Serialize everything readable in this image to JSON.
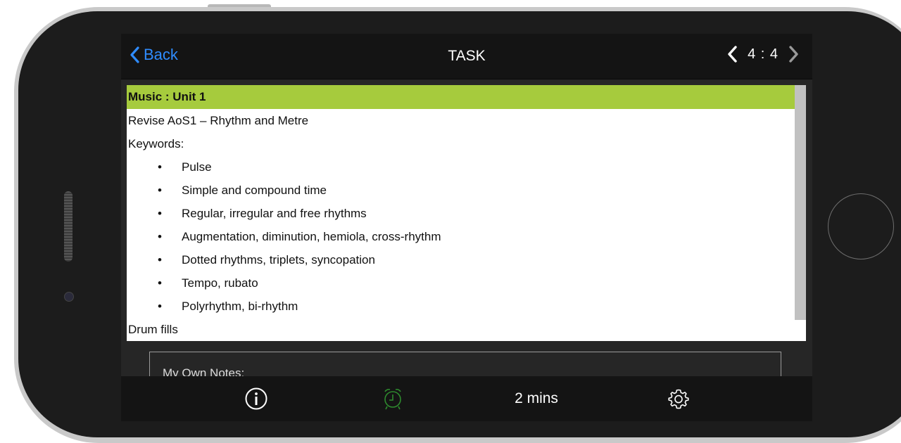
{
  "navbar": {
    "back_label": "Back",
    "title": "TASK",
    "pager_text": "4 : 4"
  },
  "task": {
    "subject": "Music : Unit 1",
    "lines": [
      "Revise AoS1 – Rhythm and Metre",
      "Keywords:"
    ],
    "bullet_char": "•",
    "bullets": [
      "Pulse",
      "Simple and compound time",
      "Regular, irregular and free rhythms",
      "Augmentation, diminution, hemiola, cross-rhythm",
      "Dotted rhythms, triplets, syncopation",
      "Tempo, rubato",
      "Polyrhythm, bi-rhythm"
    ],
    "footer_line": "Drum fills"
  },
  "notes": {
    "label": "My Own Notes:"
  },
  "toolbar": {
    "time_label": "2 mins",
    "icons": [
      "info-icon",
      "alarm-clock-icon",
      "gear-icon"
    ],
    "alarm_color": "#2e8b2e"
  },
  "colors": {
    "accent_blue": "#2f8cff",
    "subject_bar": "#a6cb3d"
  }
}
